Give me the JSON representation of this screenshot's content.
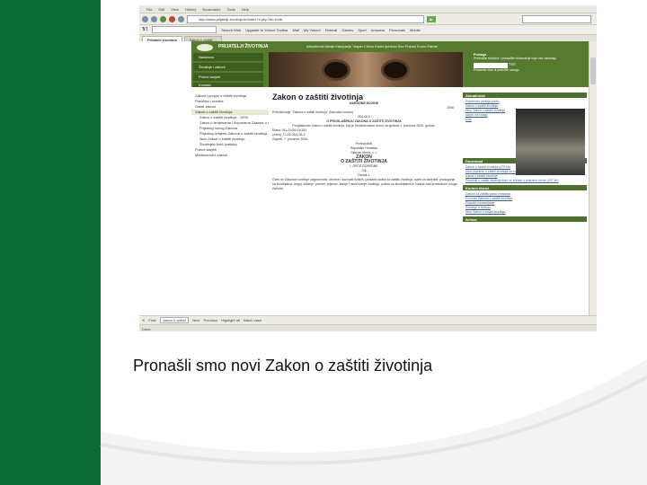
{
  "slide": {
    "caption": "Pronašli smo novi Zakon o zaštiti životinja",
    "accent_color": "#0a6b34"
  },
  "browser": {
    "menu": [
      "File",
      "Edit",
      "View",
      "History",
      "Bookmarks",
      "Tools",
      "Help"
    ],
    "url": "http://www.prijatelji-zivotinja.hr/index.hr.php?id=1046",
    "yahoo_toolbar": {
      "logo": "Y!",
      "items": [
        "Search Web",
        "Upgrade to Yahoo! Toolbar",
        "Mail",
        "My Yahoo!",
        "Hotmail",
        "Games",
        "Sport",
        "Answers",
        "Personals",
        "Mobile"
      ]
    },
    "tabs": [
      "Prijatelji životinja",
      "Zakon o zaštiti ..."
    ],
    "find": {
      "label": "Find:",
      "value": "zakon o zaštiti",
      "next": "Next",
      "previous": "Previous",
      "highlight": "Highlight all",
      "match_case": "Match case"
    },
    "status": "Done"
  },
  "site": {
    "brand": "PRIJATELJI ŽIVOTINJA",
    "top_nav": "Aktualnosti  Akcije  Kampanje  Vegan  Cirkus  Kućni ljubimci  Zoo  Pokusi  Krzno  Farme",
    "menu_buttons": [
      "Naslovna",
      "Životinje i zakoni",
      "Pravni savjeti",
      "Kontakt"
    ],
    "search": {
      "title": "Pretraga",
      "text": "Pretražite stranice i pronađite informacije koje vas zanimaju",
      "value": "Traži",
      "option": "Postanite član ili podržite udrugu"
    },
    "left_nav": [
      "Zakoni i propisi o zaštiti životinja",
      "Pravilnici i uredbe",
      "Ostali zakoni",
      "Zakon o zaštiti životinja",
      "Zakon o zaštiti životinja - 1999.",
      "Zakon o izmjenama i dopunama Zakona o zaštiti životinja",
      "Prijedlog novog Zakona",
      "Prijedlog izmjena Zakona o zaštiti životinja - 2005.",
      "Novi Zakon o zaštiti životinja",
      "Životinjski fond (zaštita)",
      "Pravni savjeti",
      "Međunarodni zakoni"
    ],
    "main": {
      "title": "Zakon o zaštiti životinja",
      "gazette": "NARODNE NOVINE",
      "year": "2006",
      "lines": [
        "Pretraživanje \"Zakona o zaštiti životinja\" (Narodne novine)",
        "ODLUKU",
        "O PROGLAŠENJU ZAKONA O ZAŠTITI ŽIVOTINJA",
        "Proglašavam Zakon o zaštiti životinja, koji je Hrvatski sabor donio na sjednici 1. prosinca 2006. godine.",
        "Klasa: 011-01/06-01/151",
        "Urbroj: 71-05-03/1-06-2",
        "Zagreb, 7. prosinca 2006.",
        "Predsjednik",
        "Republike Hrvatske",
        "Stjepan Mesić, v. r.",
        "ZAKON",
        "O ZAŠTITI ŽIVOTINJA",
        "I. OPĆE ODREDBE",
        "Cilj",
        "Članak 1.",
        "Ovim se Zakonom uređuje odgovornost, obveze i dužnosti fizičkih i pravnih osoba za zaštitu životinja, uvjeti za dobrobit, postupanje sa životinjama, uzgoj, držanje, promet, prijevoz, klanje i usmrćivanje životinja, pokusi na životinjama te nadzor nad provedbom ovoga Zakona."
      ]
    },
    "sidebar": {
      "news_title": "Aktualnosti",
      "news": [
        "Pokrenuta peticija protiv",
        "Zakon o zaštiti životinja",
        "Novi Zakon o zaštiti životinja stupio na snagu",
        "Više"
      ],
      "downloads_title": "Download",
      "downloads": [
        "Zakon o zaštiti životinja (475 kb)",
        "Novi pravilnik o zaštiti životinja za vrijeme prijevoza",
        "Izjava o zaštiti životinja",
        "Pravilnik o zaštiti životinja koje se koriste u pokusne svrhe (437 kb)"
      ],
      "useful_title": "Korisni članci",
      "useful": [
        "Zakoni za zaštitu pasa i mačaka",
        "Povrede Zakona o zaštiti životinja",
        "Prijavite zlostavljanje",
        "Životinje u cirkusu",
        "Novi Zakon o zaštiti životinja"
      ],
      "archive_title": "Arhiva"
    }
  }
}
